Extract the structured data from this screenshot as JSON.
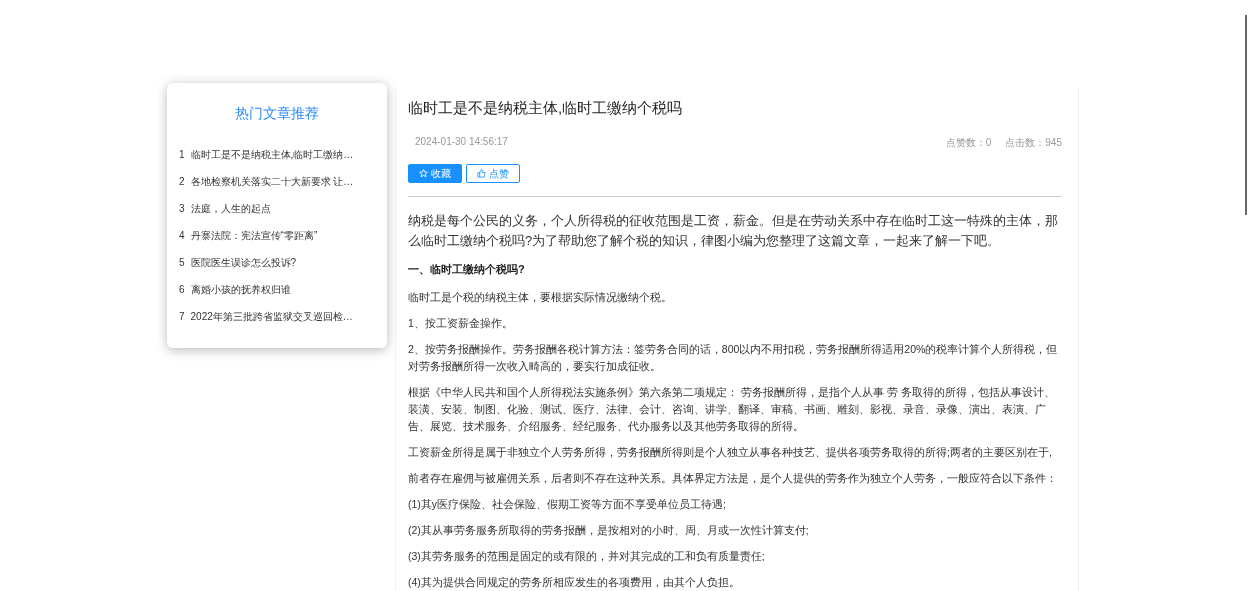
{
  "sidebar": {
    "title": "热门文章推荐",
    "items": [
      {
        "number": "1",
        "text": "临时工是不是纳税主体,临时工缴纳…"
      },
      {
        "number": "2",
        "text": "各地检察机关落实二十大新要求 让…"
      },
      {
        "number": "3",
        "text": "法庭，人生的起点"
      },
      {
        "number": "4",
        "text": "丹寨法院：宪法宣传“零距离”"
      },
      {
        "number": "5",
        "text": "医院医生误诊怎么投诉?"
      },
      {
        "number": "6",
        "text": "离婚小孩的抚养权归谁"
      },
      {
        "number": "7",
        "text": "2022年第三批跨省监狱交叉巡回检…"
      }
    ]
  },
  "article": {
    "title": "临时工是不是纳税主体,临时工缴纳个税吗",
    "date": "2024-01-30 14:56:17",
    "stats": [
      "点赞数：0",
      "点击数：945"
    ],
    "buttons": [
      {
        "kind": "primary",
        "label": "收藏"
      },
      {
        "kind": "outline",
        "label": "点赞"
      }
    ],
    "intro": "纳税是每个公民的义务，个人所得税的征收范围是工资，薪金。但是在劳动关系中存在临时工这一特殊的主体，那么临时工缴纳个税吗?为了帮助您了解个税的知识，律图小编为您整理了这篇文章，一起来了解一下吧。",
    "heading": "一、临时工缴纳个税吗?",
    "paragraphs": [
      "临时工是个税的纳税主体，要根据实际情况缴纳个税。",
      "1、按工资薪金操作。",
      "2、按劳务报酬操作。劳务报酬各税计算方法：签劳务合同的话，800以内不用扣税，劳务报酬所得适用20%的税率计算个人所得税，但对劳务报酬所得一次收入畸高的，要实行加成征收。",
      "根据《中华人民共和国个人所得税法实施条例》第六条第二项规定： 劳务报酬所得，是指个人从事 劳 务取得的所得，包括从事设计、装潢、安装、制图、化验、测试、医疗、法律、会计、咨询、讲学、翻译、审稿、书画、雕刻、影视、录音、录像、演出、表演、广告、展览、技术服务、介绍服务、经纪服务、代办服务以及其他劳务取得的所得。",
      "工资薪金所得是属于非独立个人劳务所得，劳务报酬所得则是个人独立从事各种技艺、提供各项劳务取得的所得;两者的主要区别在于,",
      "前者存在雇佣与被雇佣关系，后者则不存在这种关系。具体界定方法是，是个人提供的劳务作为独立个人劳务，一般应符合以下条件：",
      "(1)其y医疗保险、社会保险、假期工资等方面不享受单位员工待遇;",
      "(2)其从事劳务服务所取得的劳务报酬，是按相对的小时、周、月或一次性计算支付;",
      "(3)其劳务服务的范围是固定的或有限的，并对其完成的工和负有质量责任;",
      "(4)其为提供合同规定的劳务所相应发生的各项费用，由其个人负担。"
    ]
  }
}
